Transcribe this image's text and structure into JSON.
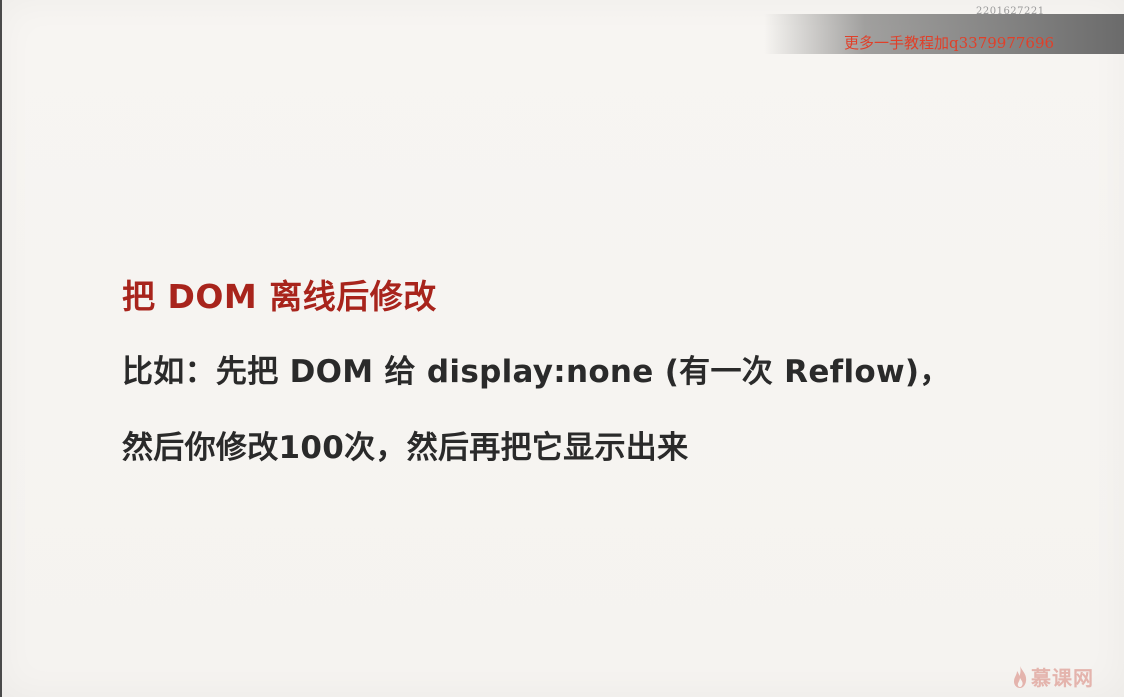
{
  "watermark": {
    "id": "2201627221",
    "text": "更多一手教程加q3379977696"
  },
  "slide": {
    "title": "把 DOM 离线后修改",
    "line1": "比如：先把 DOM 给 display:none (有一次 Reflow)，",
    "line2": "然后你修改100次，然后再把它显示出来"
  },
  "logo": {
    "text": "慕课网",
    "icon": "flame-icon",
    "color": "#e4b4ad"
  }
}
